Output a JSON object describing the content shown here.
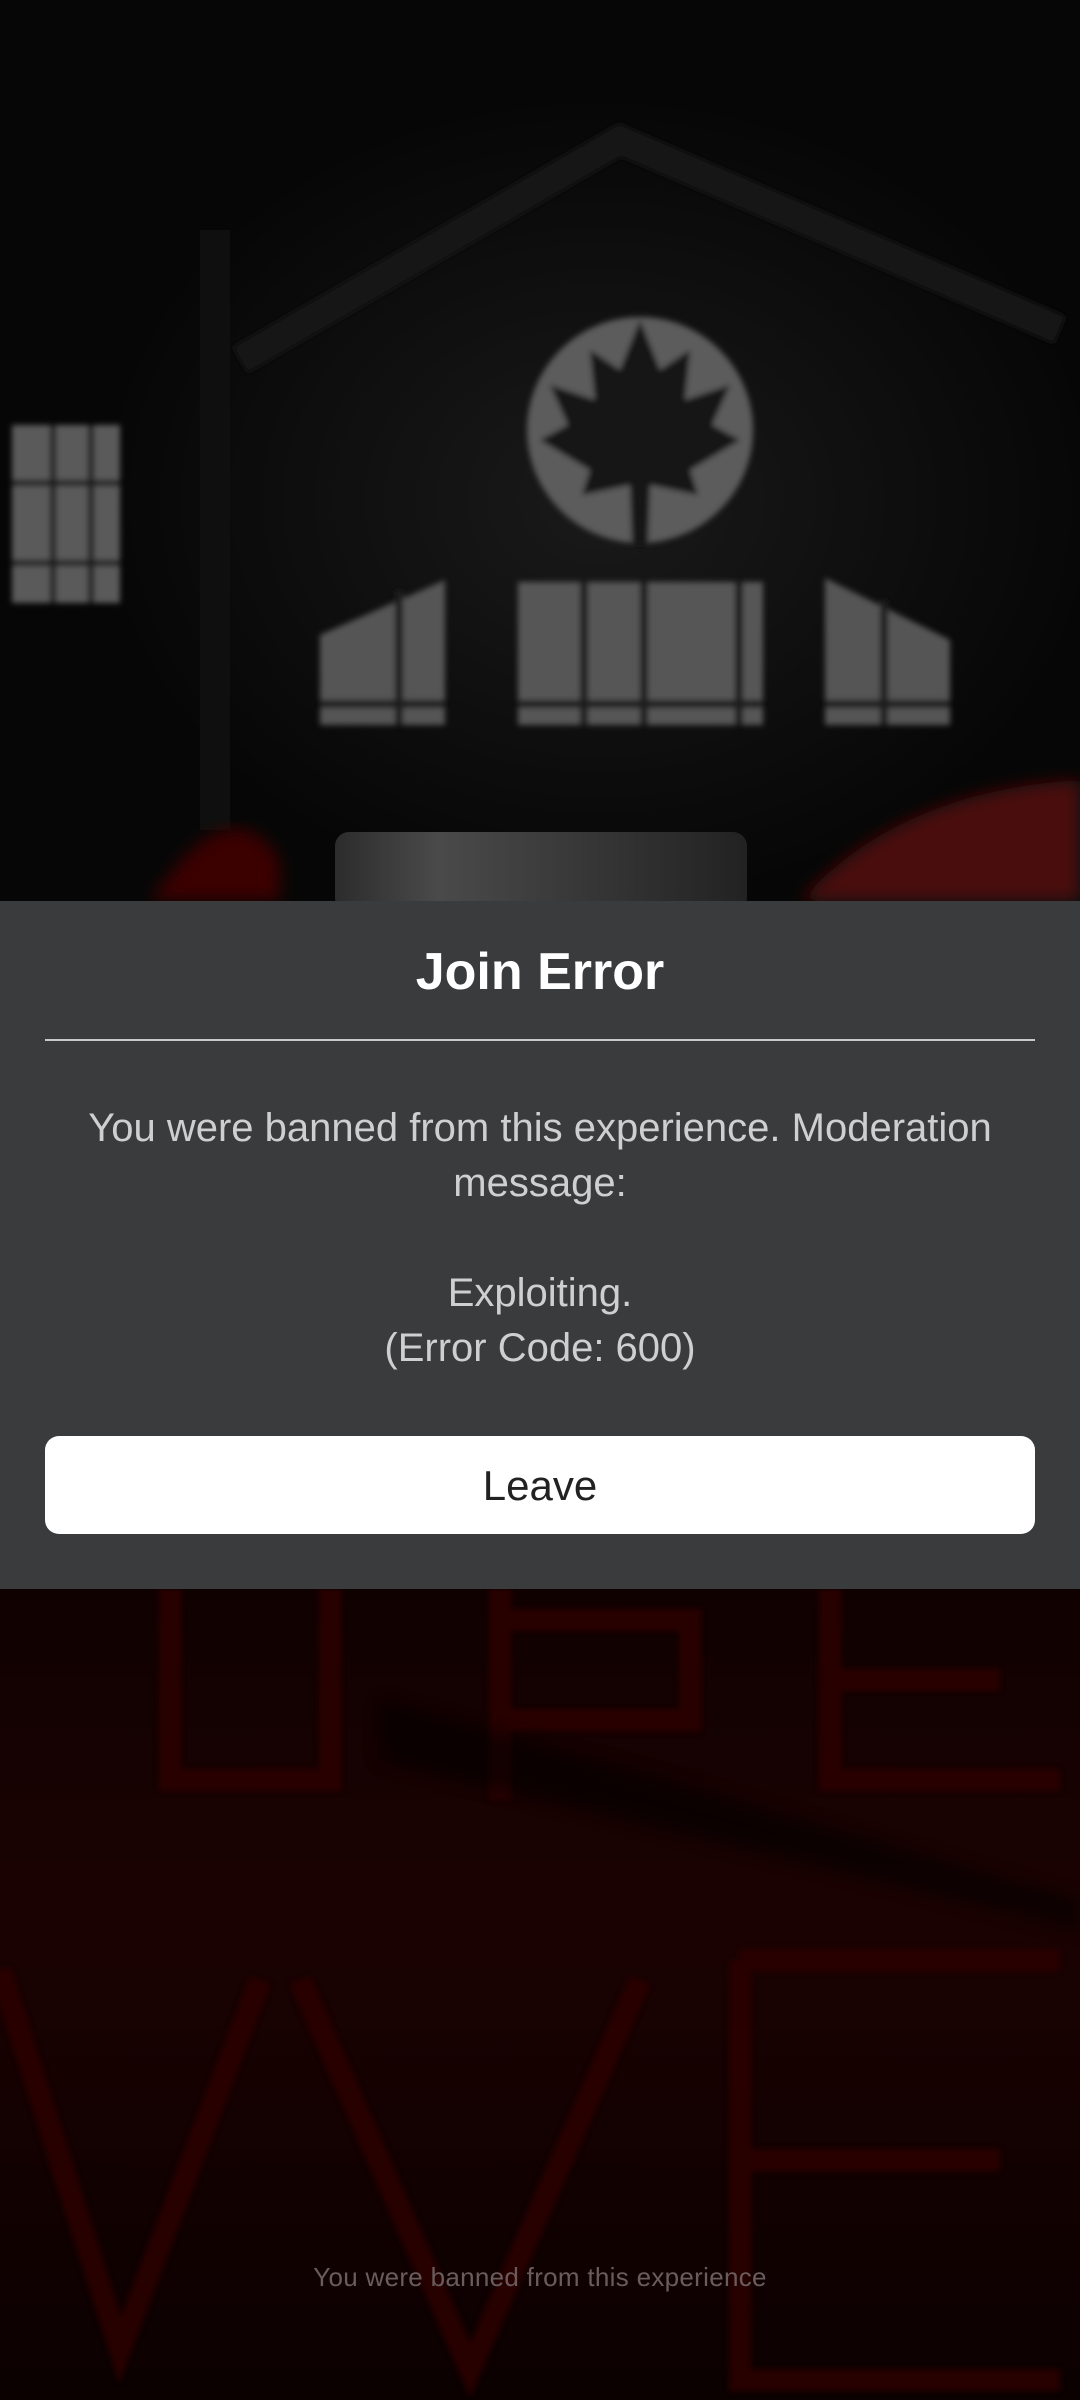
{
  "dialog": {
    "title": "Join Error",
    "message_line1": "You were banned from this experience. Moderation message:",
    "reason": "Exploiting.",
    "error_code": "(Error Code: 600)",
    "leave_label": "Leave"
  },
  "background": {
    "caption": "You were banned from this experience",
    "emblem_icon": "maple-leaf-icon"
  },
  "colors": {
    "dialog_bg": "#393b3d",
    "button_bg": "#ffffff",
    "title_text": "#ffffff",
    "body_text": "#cfcfcf",
    "accent_red": "#5a0a0a"
  }
}
